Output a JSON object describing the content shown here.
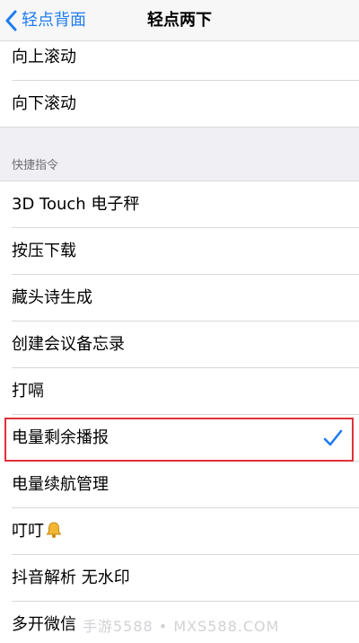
{
  "nav": {
    "back_label": "轻点背面",
    "title": "轻点两下"
  },
  "system_group": {
    "items": [
      {
        "label": "向上滚动"
      },
      {
        "label": "向下滚动"
      }
    ]
  },
  "shortcuts_section": {
    "header": "快捷指令",
    "items": [
      {
        "label": "3D Touch 电子秤",
        "selected": false
      },
      {
        "label": "按压下载",
        "selected": false
      },
      {
        "label": "藏头诗生成",
        "selected": false
      },
      {
        "label": "创建会议备忘录",
        "selected": false
      },
      {
        "label": "打嗝",
        "selected": false
      },
      {
        "label": "电量剩余播报",
        "selected": true
      },
      {
        "label": "电量续航管理",
        "selected": false
      },
      {
        "label": "叮叮",
        "icon": "bell-icon",
        "selected": false
      },
      {
        "label": "抖音解析 无水印",
        "selected": false
      },
      {
        "label": "多开微信",
        "selected": false
      }
    ]
  },
  "watermark": "手游5588 • MXS588.COM",
  "colors": {
    "accent": "#1e7cf0",
    "highlight": "#e0303a",
    "grouped_background": "#efeff4"
  }
}
